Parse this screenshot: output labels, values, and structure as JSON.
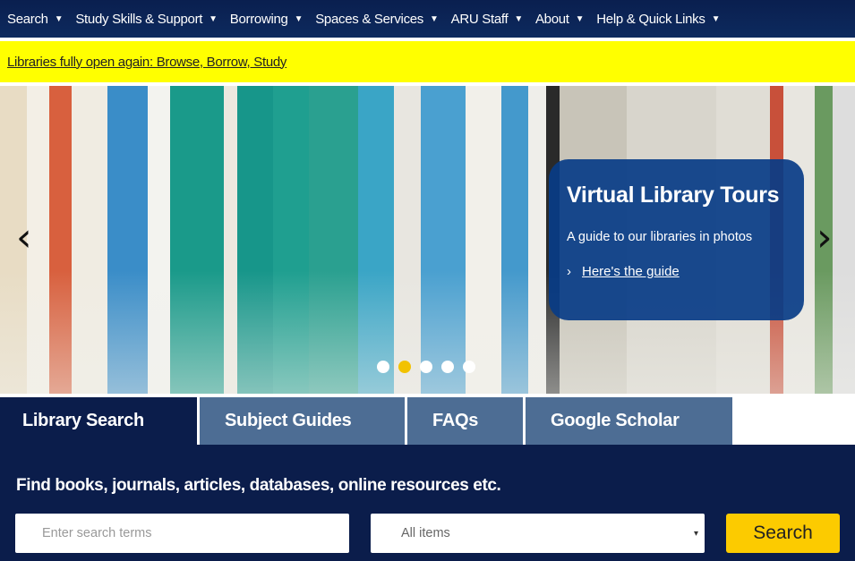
{
  "nav": {
    "items": [
      {
        "label": "Search"
      },
      {
        "label": "Study Skills & Support"
      },
      {
        "label": "Borrowing"
      },
      {
        "label": "Spaces & Services"
      },
      {
        "label": "ARU Staff"
      },
      {
        "label": "About"
      },
      {
        "label": "Help & Quick Links"
      }
    ],
    "caret": "▼"
  },
  "banner": {
    "text": "Libraries fully open again: Browse, Borrow, Study"
  },
  "hero": {
    "prev": "‹",
    "next": "›",
    "card": {
      "title": "Virtual Library Tours",
      "text": "A guide to our libraries in photos",
      "link_icon": "›",
      "link": "Here's the guide"
    },
    "slides": 5,
    "active_slide": 2
  },
  "tabs": [
    {
      "label": "Library Search",
      "active": true
    },
    {
      "label": "Subject Guides"
    },
    {
      "label": "FAQs"
    },
    {
      "label": "Google Scholar"
    }
  ],
  "search": {
    "heading": "Find books, journals, articles, databases, online resources etc.",
    "placeholder": "Enter search terms",
    "scope": "All items",
    "caret": "▾",
    "button": "Search"
  },
  "colors": {
    "nav": "#0a1f4f",
    "banner": "#ffff00",
    "panel": "#0b1d4b",
    "tab": "#4d6d94",
    "button": "#fccb00",
    "card": "#083c87"
  }
}
